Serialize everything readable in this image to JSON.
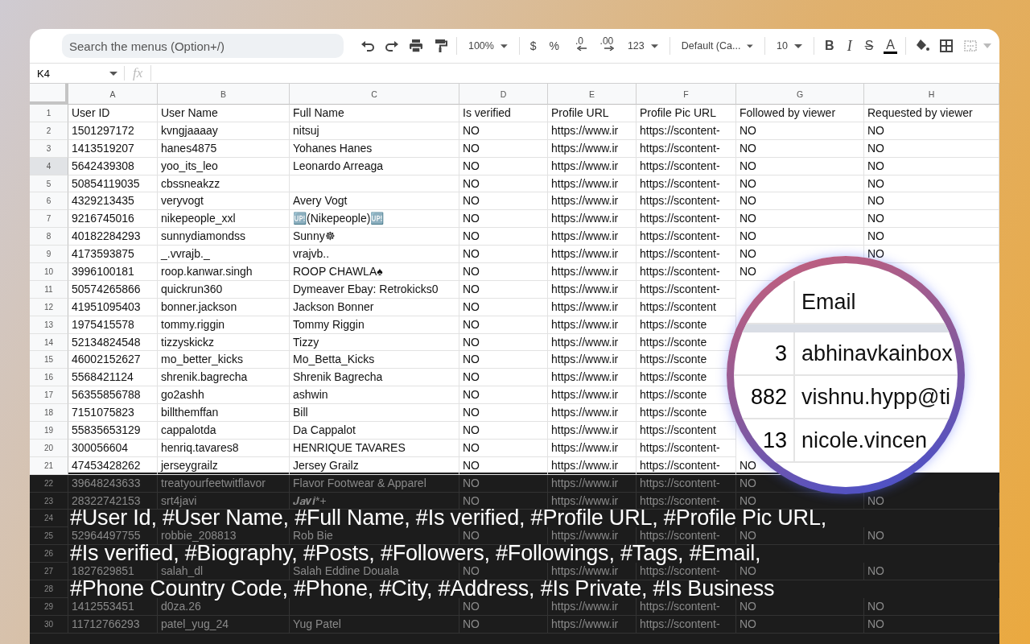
{
  "toolbar": {
    "search": {
      "placeholder": "Search the menus (Option+/)"
    },
    "items": [
      {
        "kind": "undo"
      },
      {
        "kind": "redo"
      },
      {
        "kind": "print"
      },
      {
        "kind": "paint"
      },
      {
        "kind": "sep"
      },
      {
        "kind": "dropdown",
        "label": "100%"
      },
      {
        "kind": "sep"
      },
      {
        "kind": "text",
        "label": "$"
      },
      {
        "kind": "text",
        "label": "%"
      },
      {
        "kind": "decimal_less",
        "label": ".0"
      },
      {
        "kind": "decimal_more",
        "label": ".00"
      },
      {
        "kind": "dropdown",
        "label": "123"
      },
      {
        "kind": "sep"
      },
      {
        "kind": "dropdown",
        "label": "Default (Ca..."
      },
      {
        "kind": "sep"
      },
      {
        "kind": "dropdown",
        "label": "10"
      },
      {
        "kind": "sep"
      },
      {
        "kind": "bold",
        "label": "B"
      },
      {
        "kind": "italic",
        "label": "I"
      },
      {
        "kind": "strike",
        "label": "S"
      },
      {
        "kind": "textcolor",
        "label": "A"
      },
      {
        "kind": "sep"
      },
      {
        "kind": "fill"
      },
      {
        "kind": "borders"
      },
      {
        "kind": "merge"
      },
      {
        "kind": "caret"
      }
    ]
  },
  "formula_bar": {
    "cell_ref": "K4",
    "fx": "fx"
  },
  "columns": [
    "A",
    "B",
    "C",
    "D",
    "E",
    "F",
    "G",
    "H"
  ],
  "rows": [
    {
      "number": "1",
      "selected": false,
      "cells": [
        "User ID",
        "User Name",
        "Full Name",
        "Is verified",
        "Profile URL",
        "Profile Pic URL",
        "Followed by viewer",
        "Requested by viewer"
      ]
    },
    {
      "number": "2",
      "selected": false,
      "cells": [
        "1501297172",
        "kvngjaaaay",
        "nitsuj",
        "NO",
        "https://www.ir",
        "https://scontent-",
        "NO",
        "NO"
      ]
    },
    {
      "number": "3",
      "selected": false,
      "cells": [
        "1413519207",
        "hanes4875",
        "Yohanes Hanes",
        "NO",
        "https://www.ir",
        "https://scontent-",
        "NO",
        "NO"
      ]
    },
    {
      "number": "4",
      "selected": true,
      "cells": [
        "5642439308",
        "yoo_its_leo",
        "Leonardo Arreaga",
        "NO",
        "https://www.ir",
        "https://scontent-",
        "NO",
        "NO"
      ]
    },
    {
      "number": "5",
      "selected": false,
      "cells": [
        "50854119035",
        "cbssneakzz",
        null,
        "NO",
        "https://www.ir",
        "https://scontent-",
        "NO",
        "NO"
      ]
    },
    {
      "number": "6",
      "selected": false,
      "cells": [
        "4329213435",
        "veryvogt",
        "Avery Vogt",
        "NO",
        "https://www.ir",
        "https://scontent-",
        "NO",
        "NO"
      ]
    },
    {
      "number": "7",
      "selected": false,
      "cells": [
        "9216745016",
        "nikepeople_xxl",
        "🆙(Nikepeople)🆙",
        "NO",
        "https://www.ir",
        "https://scontent-",
        "NO",
        "NO"
      ]
    },
    {
      "number": "8",
      "selected": false,
      "cells": [
        "40182284293",
        "sunnydiamondss",
        "Sunny☸",
        "NO",
        "https://www.ir",
        "https://scontent-",
        "NO",
        "NO"
      ]
    },
    {
      "number": "9",
      "selected": false,
      "cells": [
        "4173593875",
        "_.vvrajb._",
        "vrajvb..",
        "NO",
        "https://www.ir",
        "https://scontent-",
        "NO",
        "NO"
      ]
    },
    {
      "number": "10",
      "selected": false,
      "cells": [
        "3996100181",
        "roop.kanwar.singh",
        "ROOP CHAWLA♠",
        "NO",
        "https://www.ir",
        "https://scontent-",
        "NO",
        null
      ]
    },
    {
      "number": "11",
      "selected": false,
      "cells": [
        "50574265866",
        "quickrun360",
        "Dymeaver Ebay: Retrokicks0",
        "NO",
        "https://www.ir",
        "https://scontent-",
        null,
        null
      ]
    },
    {
      "number": "12",
      "selected": false,
      "cells": [
        "41951095403",
        "bonner.jackson",
        "Jackson Bonner",
        "NO",
        "https://www.ir",
        "https://scontent",
        null,
        null
      ]
    },
    {
      "number": "13",
      "selected": false,
      "cells": [
        "1975415578",
        "tommy.riggin",
        "Tommy Riggin",
        "NO",
        "https://www.ir",
        "https://sconte",
        null,
        null
      ]
    },
    {
      "number": "14",
      "selected": false,
      "cells": [
        "52134824548",
        "tizzyskickz",
        "Tizzy",
        "NO",
        "https://www.ir",
        "https://sconte",
        null,
        null
      ]
    },
    {
      "number": "15",
      "selected": false,
      "cells": [
        "46002152627",
        "mo_better_kicks",
        "Mo_Betta_Kicks",
        "NO",
        "https://www.ir",
        "https://sconte",
        null,
        null
      ]
    },
    {
      "number": "16",
      "selected": false,
      "cells": [
        "5568421124",
        "shrenik.bagrecha",
        "Shrenik Bagrecha",
        "NO",
        "https://www.ir",
        "https://sconte",
        null,
        null
      ]
    },
    {
      "number": "17",
      "selected": false,
      "cells": [
        "56355856788",
        "go2ashh",
        "ashwin",
        "NO",
        "https://www.ir",
        "https://sconte",
        null,
        null
      ]
    },
    {
      "number": "18",
      "selected": false,
      "cells": [
        "7151075823",
        "billthemffan",
        "Bill",
        "NO",
        "https://www.ir",
        "https://sconte",
        null,
        null
      ]
    },
    {
      "number": "19",
      "selected": false,
      "cells": [
        "55835653129",
        "cappalotda",
        "Da Cappalot",
        "NO",
        "https://www.ir",
        "https://scontent",
        null,
        null
      ]
    },
    {
      "number": "20",
      "selected": false,
      "cells": [
        "300056604",
        "henriq.tavares8",
        "HENRIQUE TAVARES",
        "NO",
        "https://www.ir",
        "https://scontent-",
        null,
        null
      ]
    },
    {
      "number": "21",
      "selected": false,
      "cells": [
        "47453428262",
        "jerseygrailz",
        "Jersey Grailz",
        "NO",
        "https://www.ir",
        "https://scontent-",
        "NO",
        null
      ]
    },
    {
      "number": "22",
      "selected": false,
      "cells": [
        "39648243633",
        "treatyourfeetwitflavor",
        "Flavor Footwear & Apparel",
        "NO",
        "https://www.ir",
        "https://scontent-",
        "NO",
        null
      ]
    },
    {
      "number": "23",
      "selected": false,
      "cells": [
        "28322742153",
        "srt4javi",
        "𝑱𝒂𝒗𝒊*+",
        "NO",
        "https://www.ir",
        "https://scontent-",
        "NO",
        "NO"
      ]
    },
    {
      "number": "24",
      "selected": false
    },
    {
      "number": "25",
      "selected": false,
      "cells": [
        "52964497755",
        "robbie_208813",
        "Rob Bie",
        "NO",
        "https://www.ir",
        "https://scontent-",
        "NO",
        "NO"
      ]
    },
    {
      "number": "26",
      "selected": false
    },
    {
      "number": "27",
      "selected": false,
      "cells": [
        "1827629851",
        "salah_dl",
        "Salah Eddine Douala",
        "NO",
        "https://www.ir",
        "https://scontent-",
        "NO",
        "NO"
      ]
    },
    {
      "number": "28",
      "selected": false
    },
    {
      "number": "29",
      "selected": false,
      "cells": [
        "1412553451",
        "d0za.26",
        null,
        "NO",
        "https://www.ir",
        "https://scontent-",
        "NO",
        "NO"
      ]
    },
    {
      "number": "30",
      "selected": false,
      "cells": [
        "11712766293",
        "patel_yug_24",
        "Yug Patel",
        "NO",
        "https://www.ir",
        "https://scontent-",
        "NO",
        "NO"
      ]
    }
  ],
  "magnifier": {
    "header": "Email",
    "rows": [
      {
        "number": "3",
        "email": "abhinavkainbox"
      },
      {
        "number": "882",
        "email": "vishnu.hypp@ti"
      },
      {
        "number": "13",
        "email": "nicole.vincen"
      }
    ]
  },
  "caption": [
    "#User Id, #User Name, #Full Name, #Is verified, #Profile URL, #Profile Pic URL,",
    "#Is verified, #Biography, #Posts, #Followers, #Followings, #Tags, #Email,",
    "#Phone Country Code, #Phone, #City, #Address, #Is Private, #Is Business"
  ]
}
